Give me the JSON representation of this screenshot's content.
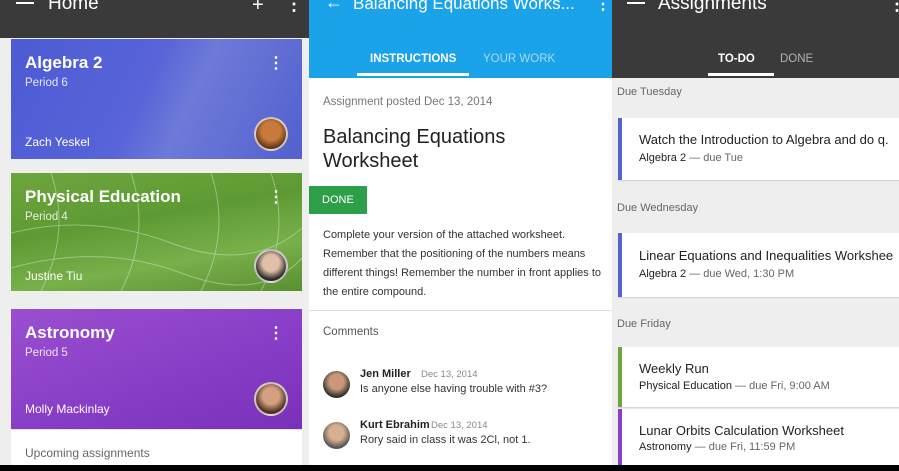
{
  "home": {
    "title": "Home",
    "add_icon": "+",
    "overflow_icon": "⋮",
    "classes": [
      {
        "name": "Algebra 2",
        "period": "Period 6",
        "teacher": "Zach Yeskel",
        "color": "#5360cf"
      },
      {
        "name": "Physical Education",
        "period": "Period 4",
        "teacher": "Justine Tiu",
        "color": "#6ea53d"
      },
      {
        "name": "Astronomy",
        "period": "Period 5",
        "teacher": "Molly Mackinlay",
        "color": "#8a3fc8"
      }
    ],
    "card_menu_icon": "⋮",
    "upcoming": "Upcoming assignments"
  },
  "assignment": {
    "title": "Balancing Equations Works...",
    "back_icon": "←",
    "overflow_icon": "⋮",
    "tabs": [
      {
        "label": "INSTRUCTIONS",
        "active": true
      },
      {
        "label": "YOUR WORK",
        "active": false
      }
    ],
    "posted": "Assignment posted Dec 13, 2014",
    "name": "Balancing Equations Worksheet",
    "done_label": "DONE",
    "instructions": "Complete your version of the attached worksheet. Remember that the positioning of the numbers means different things! Remember the number in front applies to the entire compound.",
    "comments_header": "Comments",
    "comments": [
      {
        "author": "Jen Miller",
        "date": "Dec 13, 2014",
        "text": "Is anyone else having trouble with #3?"
      },
      {
        "author": "Kurt Ebrahim",
        "date": "Dec 13, 2014",
        "text": "Rory said in class it was 2Cl, not 1."
      }
    ],
    "accent": "#1aa3e8",
    "done_color": "#2e9f49"
  },
  "assignments": {
    "title": "Assignments",
    "overflow_icon": "⋮",
    "tabs": [
      {
        "label": "TO-DO",
        "active": true
      },
      {
        "label": "DONE",
        "active": false
      }
    ],
    "groups": [
      {
        "header": "Due Tuesday",
        "items": [
          {
            "title": "Watch the Introduction to Algebra and do q.",
            "class": "Algebra 2",
            "due": "due Tue",
            "color": "#5464c8"
          }
        ]
      },
      {
        "header": "Due Wednesday",
        "items": [
          {
            "title": "Linear Equations and Inequalities Workshee",
            "class": "Algebra 2",
            "due": "due Wed, 1:30 PM",
            "color": "#5464c8"
          }
        ]
      },
      {
        "header": "Due Friday",
        "items": [
          {
            "title": "Weekly Run",
            "class": "Physical Education",
            "due": "due Fri, 9:00 AM",
            "color": "#6ea53d"
          },
          {
            "title": "Lunar Orbits Calculation Worksheet",
            "class": "Astronomy",
            "due": "due Fri, 11:59 PM",
            "color": "#8a3fc8"
          }
        ]
      }
    ],
    "separator": "—"
  }
}
